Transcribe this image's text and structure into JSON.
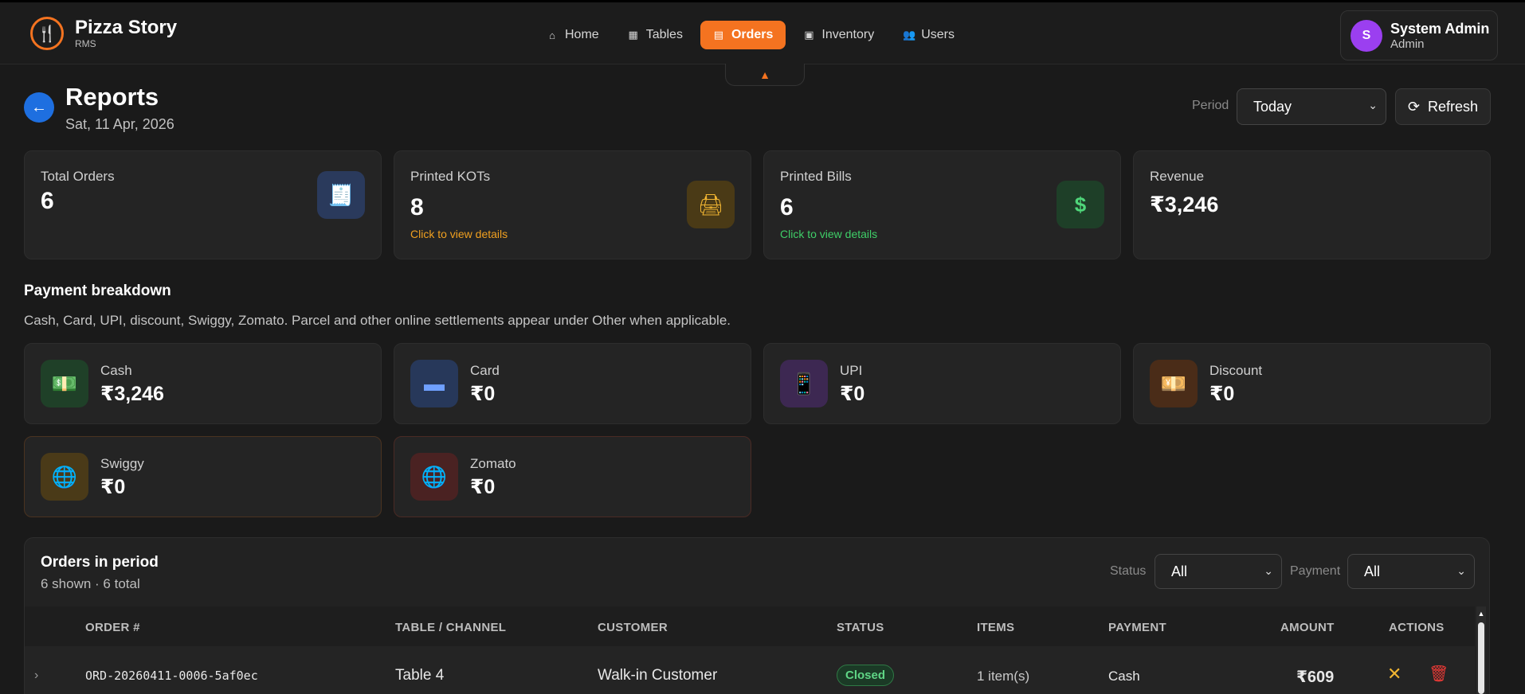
{
  "brand": {
    "name": "Pizza Story",
    "sub": "RMS",
    "logo_icon": "🍴"
  },
  "nav": [
    {
      "label": "Home",
      "icon": "⌂",
      "icon_name": "home-icon"
    },
    {
      "label": "Tables",
      "icon": "▦",
      "icon_name": "grid-icon"
    },
    {
      "label": "Orders",
      "icon": "▤",
      "icon_name": "receipt-icon",
      "active": true
    },
    {
      "label": "Inventory",
      "icon": "▣",
      "icon_name": "archive-icon"
    },
    {
      "label": "Users",
      "icon": "👥",
      "icon_name": "users-icon"
    }
  ],
  "user": {
    "initial": "S",
    "name": "System Admin",
    "role": "Admin"
  },
  "header": {
    "title": "Reports",
    "date": "Sat, 11 Apr, 2026",
    "period_label": "Period",
    "period_value": "Today",
    "refresh_label": "Refresh"
  },
  "stats": [
    {
      "label": "Total Orders",
      "value": "6",
      "link": "",
      "icon": "🧾",
      "icon_bg": "#2a3a5c",
      "icon_color": "#6fa0ff"
    },
    {
      "label": "Printed KOTs",
      "value": "8",
      "link": "Click to view details",
      "link_color": "#f0a020",
      "icon": "🖨",
      "icon_bg": "#4a3a16",
      "icon_color": "#f2b632"
    },
    {
      "label": "Printed Bills",
      "value": "6",
      "link": "Click to view details",
      "link_color": "#3fcf68",
      "icon": "$",
      "icon_bg": "#1e3f28",
      "icon_color": "#4fd67a"
    },
    {
      "label": "Revenue",
      "value": "₹3,246",
      "link": ""
    }
  ],
  "payment": {
    "title": "Payment breakdown",
    "subtitle": "Cash, Card, UPI, discount, Swiggy, Zomato. Parcel and other online settlements appear under Other when applicable.",
    "items": [
      {
        "label": "Cash",
        "value": "₹3,246",
        "icon": "💵",
        "icon_name": "cash-icon",
        "icon_bg": "#1f4028"
      },
      {
        "label": "Card",
        "value": "₹0",
        "icon": "▬",
        "icon_name": "card-icon",
        "icon_bg": "#27385a"
      },
      {
        "label": "UPI",
        "value": "₹0",
        "icon": "📱",
        "icon_name": "phone-icon",
        "icon_bg": "#3d2852"
      },
      {
        "label": "Discount",
        "value": "₹0",
        "icon": "💴",
        "icon_name": "money-icon",
        "icon_bg": "#4a2c18"
      },
      {
        "label": "Swiggy",
        "value": "₹0",
        "icon": "🌐",
        "icon_name": "globe-icon",
        "icon_bg": "#4a3a18"
      },
      {
        "label": "Zomato",
        "value": "₹0",
        "icon": "🌐",
        "icon_name": "globe-icon",
        "icon_bg": "#4a2222"
      }
    ]
  },
  "orders": {
    "title": "Orders in period",
    "subtitle": "6 shown · 6 total",
    "status_label": "Status",
    "status_value": "All",
    "payment_label": "Payment",
    "payment_value": "All",
    "columns": [
      "ORDER #",
      "TABLE / CHANNEL",
      "CUSTOMER",
      "STATUS",
      "ITEMS",
      "PAYMENT",
      "AMOUNT",
      "ACTIONS"
    ],
    "rows": [
      {
        "order": "ORD-20260411-0006-5af0ec",
        "table": "Table 4",
        "customer": "Walk-in Customer",
        "status": "Closed",
        "items": "1 item(s)",
        "payment": "Cash",
        "amount": "₹609"
      }
    ]
  }
}
